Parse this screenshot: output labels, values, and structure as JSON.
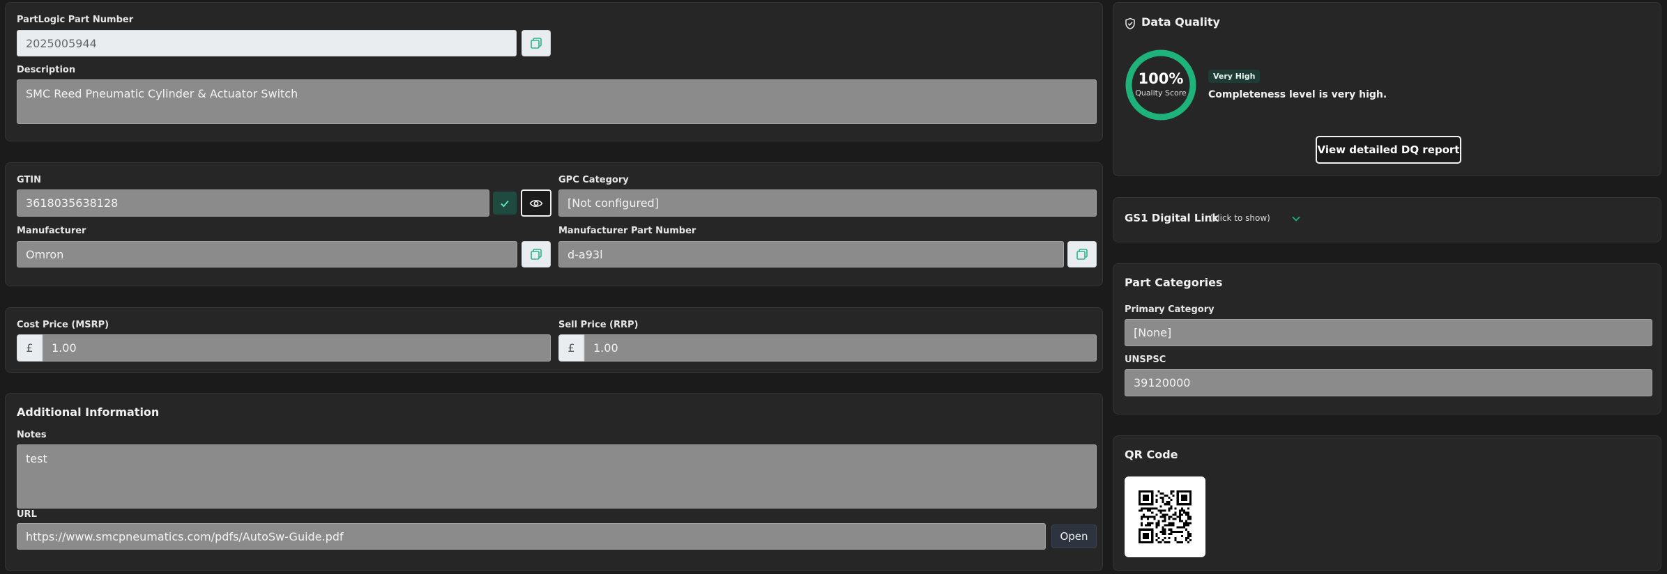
{
  "identity": {
    "part_number_label": "PartLogic Part Number",
    "part_number_value": "2025005944",
    "description_label": "Description",
    "description_value": "SMC Reed Pneumatic Cylinder & Actuator Switch"
  },
  "product": {
    "gtin_label": "GTIN",
    "gtin_value": "3618035638128",
    "gpc_label": "GPC Category",
    "gpc_value": "[Not configured]",
    "manufacturer_label": "Manufacturer",
    "manufacturer_value": "Omron",
    "mpn_label": "Manufacturer Part Number",
    "mpn_value": "d-a93l"
  },
  "pricing": {
    "cost_label": "Cost Price (MSRP)",
    "cost_currency": "£",
    "cost_value": "1.00",
    "sell_label": "Sell Price (RRP)",
    "sell_currency": "£",
    "sell_value": "1.00"
  },
  "additional": {
    "title": "Additional Information",
    "notes_label": "Notes",
    "notes_value": "test",
    "url_label": "URL",
    "url_value": "https://www.smcpneumatics.com/pdfs/AutoSw-Guide.pdf",
    "open_button": "Open"
  },
  "data_quality": {
    "title": "Data Quality",
    "score_text": "100%",
    "score_percent": 100,
    "score_caption": "Quality Score",
    "badge": "Very High",
    "completeness": "Completeness level is very high.",
    "report_button": "View detailed DQ report",
    "ring_color": "#1db37a"
  },
  "gs1": {
    "title": "GS1 Digital Link",
    "hint": "(click to show)"
  },
  "categories": {
    "title": "Part Categories",
    "primary_label": "Primary Category",
    "primary_value": "[None]",
    "unspsc_label": "UNSPSC",
    "unspsc_value": "39120000"
  },
  "qr": {
    "title": "QR Code"
  },
  "icons": {
    "copy": "copy-icon",
    "check": "check-icon",
    "eye": "eye-icon",
    "shield": "shield-check-icon",
    "chevron": "chevron-down-icon"
  },
  "colors": {
    "accent": "#1db37a",
    "badge_bg": "#1f3b36"
  }
}
